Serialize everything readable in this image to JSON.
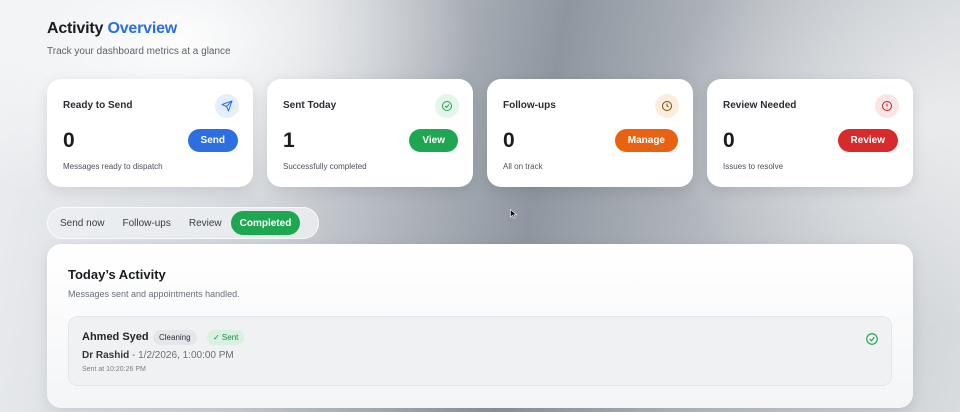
{
  "header": {
    "title_main": "Activity",
    "title_accent": "Overview",
    "subtitle": "Track your dashboard metrics at a glance"
  },
  "cards": [
    {
      "title": "Ready to Send",
      "count": "0",
      "button": "Send",
      "description": "Messages ready to dispatch",
      "icon": "paper-plane-icon",
      "color": "#2d6fe0"
    },
    {
      "title": "Sent Today",
      "count": "1",
      "button": "View",
      "description": "Successfully completed",
      "icon": "check-circle-icon",
      "color": "#1fa650"
    },
    {
      "title": "Follow-ups",
      "count": "0",
      "button": "Manage",
      "description": "All on track",
      "icon": "clock-icon",
      "color": "#e8620f"
    },
    {
      "title": "Review Needed",
      "count": "0",
      "button": "Review",
      "description": "Issues to resolve",
      "icon": "alert-circle-icon",
      "color": "#d72a2a"
    }
  ],
  "tabs": [
    {
      "label": "Send now",
      "active": false
    },
    {
      "label": "Follow-ups",
      "active": false
    },
    {
      "label": "Review",
      "active": false
    },
    {
      "label": "Completed",
      "active": true
    }
  ],
  "activity_panel": {
    "title": "Today’s Activity",
    "subtitle": "Messages sent and appointments handled.",
    "items": [
      {
        "name": "Ahmed Syed",
        "tag": "Cleaning",
        "status": "✓ Sent",
        "doctor": "Dr Rashid",
        "appointment": " - 1/2/2026, 1:00:00 PM",
        "sent_at": "Sent at 10:20:26 PM"
      }
    ]
  }
}
